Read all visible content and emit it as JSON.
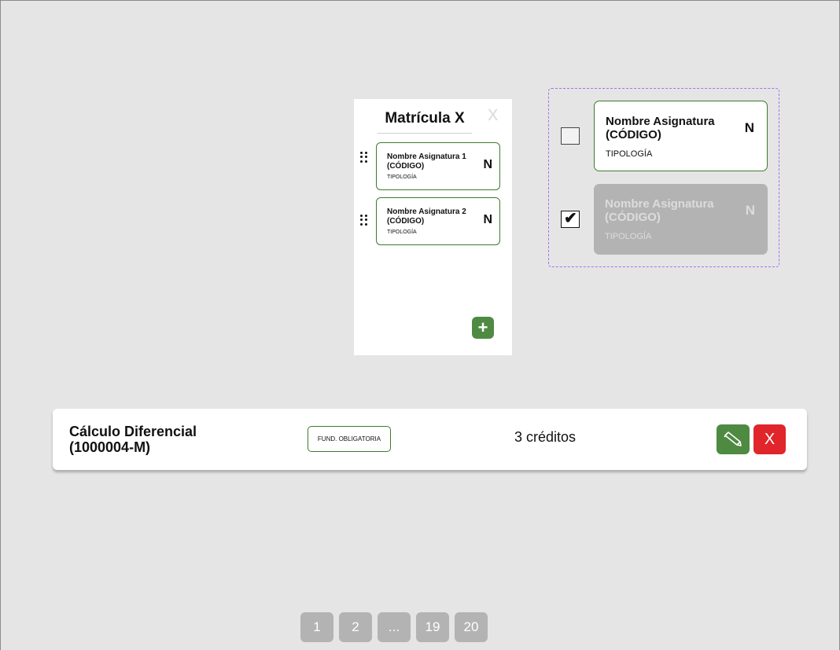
{
  "matricula": {
    "title": "Matrícula X",
    "close_label": "X",
    "items": [
      {
        "name": "Nombre Asignatura 1 (CÓDIGO)",
        "tipologia": "TIPOLOGÍA",
        "grade": "N"
      },
      {
        "name": "Nombre Asignatura 2 (CÓDIGO)",
        "tipologia": "TIPOLOGÍA",
        "grade": "N"
      }
    ],
    "add_label": "+"
  },
  "variants": [
    {
      "checked": false,
      "name": "Nombre Asignatura (CÓDIGO)",
      "tipologia": "TIPOLOGÍA",
      "grade": "N"
    },
    {
      "checked": true,
      "name": "Nombre Asignatura (CÓDIGO)",
      "tipologia": "TIPOLOGÍA",
      "grade": "N"
    }
  ],
  "course": {
    "name_line1": "Cálculo Diferencial",
    "name_line2": "(1000004-M)",
    "tipologia": "FUND. OBLIGATORIA",
    "credits": "3 créditos",
    "delete_label": "X"
  },
  "pagination": {
    "pages": [
      "1",
      "2",
      "...",
      "19",
      "20"
    ]
  },
  "colors": {
    "background": "#e5e5e5",
    "green": "#4f8a43",
    "red": "#e0252b",
    "disabled_gray": "#b3b3b3",
    "dashed_purple": "#a970f0"
  }
}
